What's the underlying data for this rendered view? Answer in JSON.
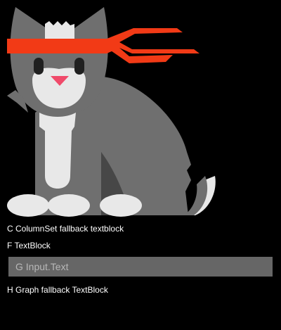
{
  "image": {
    "icon": "ninja-cat-image",
    "colors": {
      "background": "#000000",
      "fur": "#6f6f6f",
      "fur_light": "#e6e6e6",
      "headband": "#f23a16",
      "nose": "#f04a6a",
      "eyes": "#202020"
    }
  },
  "column_set": {
    "fallback_text": "C ColumnSet fallback textblock"
  },
  "text_block": {
    "text": "F TextBlock"
  },
  "input": {
    "placeholder": "G Input.Text",
    "value": ""
  },
  "graph": {
    "fallback_text": "H Graph fallback TextBlock"
  }
}
